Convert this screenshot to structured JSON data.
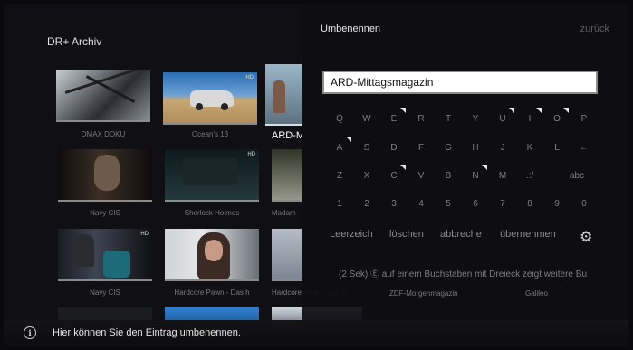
{
  "archive": {
    "title": "DR+ Archiv",
    "tiles": [
      {
        "label": "DMAX DOKU"
      },
      {
        "label": "Ocean's 13"
      },
      {
        "label": "ARD-M"
      },
      {
        "label": "Navy CIS"
      },
      {
        "label": "Sherlock Holmes"
      },
      {
        "label": "Madam"
      },
      {
        "label": "Navy CIS"
      },
      {
        "label": "Hardcore Pawn - Das h"
      },
      {
        "label": "Hardcore Pawn - Das h"
      }
    ],
    "bottom_labels": [
      "ZDF-Morgenmagazin",
      "Galileo"
    ]
  },
  "rename": {
    "title": "Umbenennen",
    "back_label": "zurück",
    "input_value": "ARD-Mittagsmagazin",
    "keys": [
      [
        "Q",
        "W",
        "E",
        "R",
        "T",
        "Y",
        "U",
        "I",
        "O",
        "P"
      ],
      [
        "A",
        "S",
        "D",
        "F",
        "G",
        "H",
        "J",
        "K",
        "L",
        "←"
      ],
      [
        "Z",
        "X",
        "C",
        "V",
        "B",
        "N",
        "M",
        ".:/",
        "",
        "abc"
      ],
      [
        "1",
        "2",
        "3",
        "4",
        "5",
        "6",
        "7",
        "8",
        "9",
        "0"
      ]
    ],
    "actions": {
      "space": "Leerzeich",
      "delete": "löschen",
      "cancel": "abbreche",
      "accept": "übernehmen"
    },
    "hint": "(2 Sek) Ⓔ auf einem Buchstaben mit Dreieck zeigt weitere Bu"
  },
  "infobar": {
    "text": "Hier können Sie den Eintrag umbenennen."
  },
  "icons": {
    "info": "info-icon",
    "settings": "gear-icon"
  }
}
